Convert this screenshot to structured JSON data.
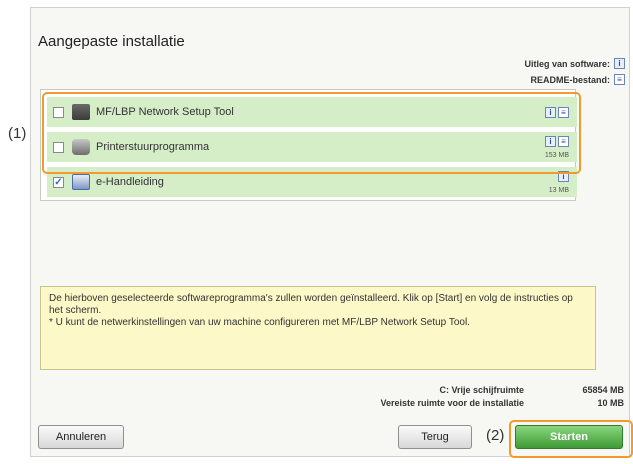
{
  "title": "Aangepaste installatie",
  "help": {
    "software_label": "Uitleg van software:",
    "readme_label": "README-bestand:"
  },
  "items": [
    {
      "label": "MF/LBP Network Setup Tool",
      "checked": false,
      "size": ""
    },
    {
      "label": "Printerstuurprogramma",
      "checked": false,
      "size": "153 MB"
    },
    {
      "label": "e-Handleiding",
      "checked": true,
      "size": "13 MB"
    }
  ],
  "annotations": {
    "one": "(1)",
    "two": "(2)"
  },
  "note": {
    "line1": "De hierboven geselecteerde softwareprogramma's zullen worden geïnstalleerd. Klik op [Start] en volg de instructies op het scherm.",
    "line2": "* U kunt de netwerkinstellingen van uw machine configureren met MF/LBP Network Setup Tool."
  },
  "disk": {
    "free_label": "C: Vrije schijfruimte",
    "free_value": "65854 MB",
    "required_label": "Vereiste ruimte voor de installatie",
    "required_value": "10 MB"
  },
  "buttons": {
    "cancel": "Annuleren",
    "back": "Terug",
    "start": "Starten"
  },
  "colors": {
    "row_bg": "#d6eec8",
    "highlight": "#f29a2e",
    "note_bg": "#fcf8c8",
    "start_btn": "#3f9a35"
  }
}
